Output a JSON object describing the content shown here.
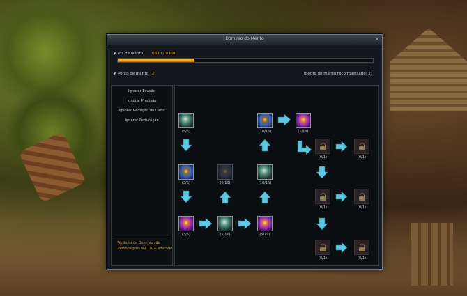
{
  "window": {
    "title": "Domínio do Mérito",
    "close_glyph": "×"
  },
  "merit_points": {
    "label": "Pts de Mérito",
    "value": "6820 / 9360",
    "progress": 0.3
  },
  "merit_point": {
    "label": "Ponto de mérito",
    "value": "2",
    "rewarded_note": "(ponto de mérito recompensado: 2)"
  },
  "options": [
    "Ignorar Evasão",
    "Ignorar Precisão",
    "Ignorar Redução de Dano",
    "Ignorar Perfuração"
  ],
  "note": "Atributo de Domínio são Personagens Nv 170+ aplicado",
  "nodes": {
    "n1": "(5/5)",
    "n2": "(10/15)",
    "n3": "(1/15)",
    "n4": "(3/5)",
    "n5": "(0/10)",
    "n6": "(10/15)",
    "n7": "(3/5)",
    "n8": "(5/10)",
    "n9": "(5/10)",
    "l1": "(0/1)",
    "l2": "(0/1)",
    "l3": "(0/1)",
    "l4": "(0/1)",
    "l5": "(0/1)",
    "l6": "(0/1)"
  },
  "icons": {
    "n1": "teal-skill-icon",
    "n2": "blue-skill-icon",
    "n3": "purple-skill-icon",
    "n4": "blue-skill-icon",
    "n5": "blue-skill-icon",
    "n6": "teal-skill-icon",
    "n7": "purple-skill-icon",
    "n8": "teal-skill-icon",
    "n9": "purple-skill-icon",
    "lock": "lock-icon"
  },
  "colors": {
    "accent": "#f0a020",
    "arrow": "#5cc8e0"
  }
}
